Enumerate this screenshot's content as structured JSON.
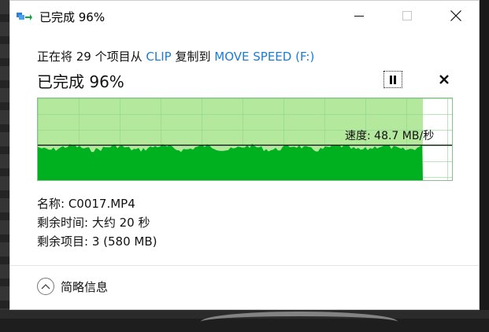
{
  "window": {
    "title": "已完成 96%",
    "controls": {
      "minimize": "minimize-icon",
      "maximize": "maximize-icon",
      "close": "close-icon"
    }
  },
  "copy": {
    "prefix": "正在将 29 个项目从 ",
    "source": "CLIP",
    "middle": " 复制到 ",
    "destination": "MOVE SPEED (F:)",
    "status_big": "已完成 96%",
    "progress_percent": 96
  },
  "graph": {
    "speed_label": "速度: 48.7 MB/秒",
    "fill_color": "#00b11f",
    "done_color": "#b3e89d",
    "grid_color": "#8fd58f"
  },
  "details": {
    "name": "名称: C0017.MP4",
    "time_left": "剩余时间: 大约 20 秒",
    "items_left": "剩余项目: 3 (580 MB)"
  },
  "footer": {
    "toggle_label": "简略信息"
  },
  "colors": {
    "link": "#1e7bd1"
  }
}
